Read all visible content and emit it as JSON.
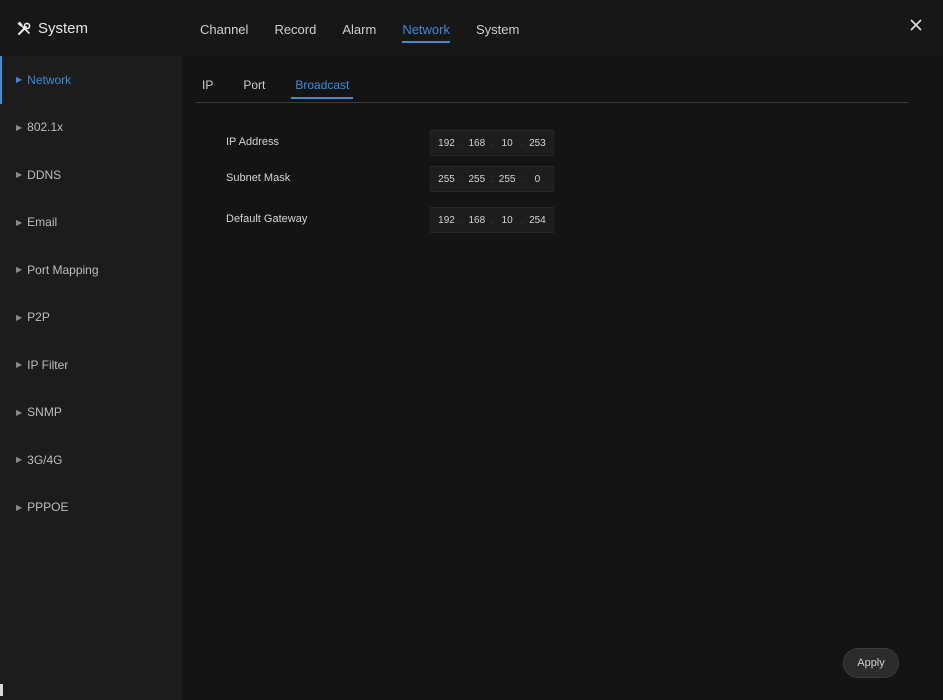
{
  "app": {
    "title": "System"
  },
  "top_tabs": [
    {
      "label": "Channel",
      "active": false
    },
    {
      "label": "Record",
      "active": false
    },
    {
      "label": "Alarm",
      "active": false
    },
    {
      "label": "Network",
      "active": true
    },
    {
      "label": "System",
      "active": false
    }
  ],
  "sidebar": {
    "items": [
      {
        "label": "Network",
        "active": true
      },
      {
        "label": "802.1x",
        "active": false
      },
      {
        "label": "DDNS",
        "active": false
      },
      {
        "label": "Email",
        "active": false
      },
      {
        "label": "Port Mapping",
        "active": false
      },
      {
        "label": "P2P",
        "active": false
      },
      {
        "label": "IP Filter",
        "active": false
      },
      {
        "label": "SNMP",
        "active": false
      },
      {
        "label": "3G/4G",
        "active": false
      },
      {
        "label": "PPPOE",
        "active": false
      }
    ]
  },
  "sub_tabs": [
    {
      "label": "IP",
      "active": false
    },
    {
      "label": "Port",
      "active": false
    },
    {
      "label": "Broadcast",
      "active": true
    }
  ],
  "form": {
    "ip_address": {
      "label": "IP Address",
      "octets": [
        "192",
        "168",
        "10",
        "253"
      ]
    },
    "subnet_mask": {
      "label": "Subnet Mask",
      "octets": [
        "255",
        "255",
        "255",
        "0"
      ]
    },
    "default_gateway": {
      "label": "Default Gateway",
      "octets": [
        "192",
        "168",
        "10",
        "254"
      ]
    }
  },
  "apply_label": "Apply",
  "colors": {
    "accent": "#3d8ad9",
    "background": "#141414",
    "sidebar": "#1c1c1c"
  }
}
